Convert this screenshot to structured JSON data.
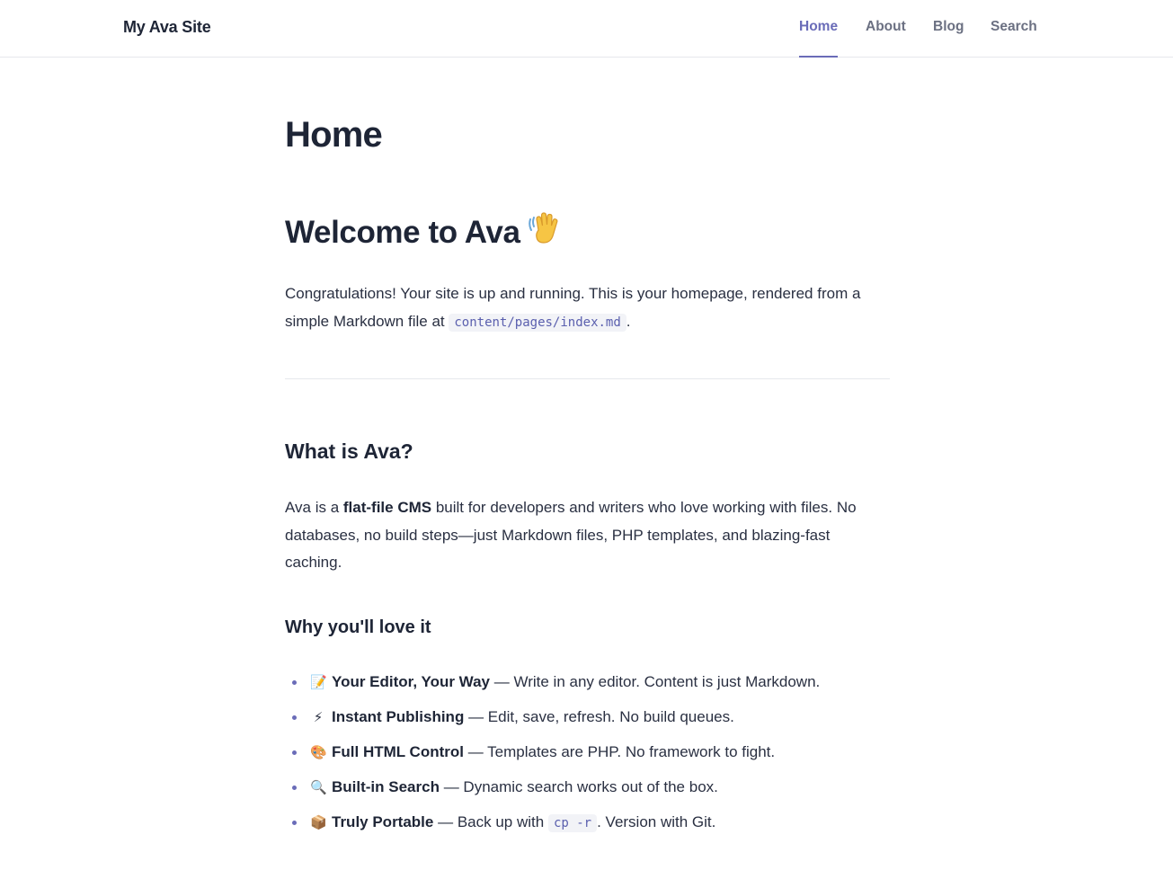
{
  "header": {
    "site_title": "My Ava Site",
    "nav": [
      {
        "label": "Home",
        "active": true
      },
      {
        "label": "About",
        "active": false
      },
      {
        "label": "Blog",
        "active": false
      },
      {
        "label": "Search",
        "active": false
      }
    ]
  },
  "colors": {
    "accent": "#6a6cb8",
    "text": "#1e2536",
    "nav_inactive": "#6b7082",
    "divider": "#e6e8ec"
  },
  "main": {
    "page_title": "Home",
    "welcome_heading": "Welcome to Ava",
    "welcome_emoji": "👋",
    "intro_text": "Congratulations! Your site is up and running. This is your homepage, rendered from a simple Markdown file at",
    "intro_code": "content/pages/index.md",
    "intro_end": ".",
    "what_heading": "What is Ava?",
    "about_prefix": "Ava is a ",
    "about_bold": "flat-file CMS",
    "about_rest": " built for developers and writers who love working with files. No databases, no build steps—just Markdown files, PHP templates, and blazing-fast caching.",
    "why_heading": "Why you'll love it",
    "features": [
      {
        "emoji": "📝",
        "title": "Your Editor, Your Way",
        "desc": " — Write in any editor. Content is just Markdown."
      },
      {
        "emoji": "⚡",
        "title": "Instant Publishing",
        "desc": " — Edit, save, refresh. No build queues."
      },
      {
        "emoji": "🎨",
        "title": "Full HTML Control",
        "desc": " — Templates are PHP. No framework to fight."
      },
      {
        "emoji": "🔍",
        "title": "Built-in Search",
        "desc": " — Dynamic search works out of the box."
      },
      {
        "emoji": "📦",
        "title": "Truly Portable",
        "desc": " — Back up with ",
        "code": "cp -r",
        "desc_end": ". Version with Git."
      }
    ]
  }
}
